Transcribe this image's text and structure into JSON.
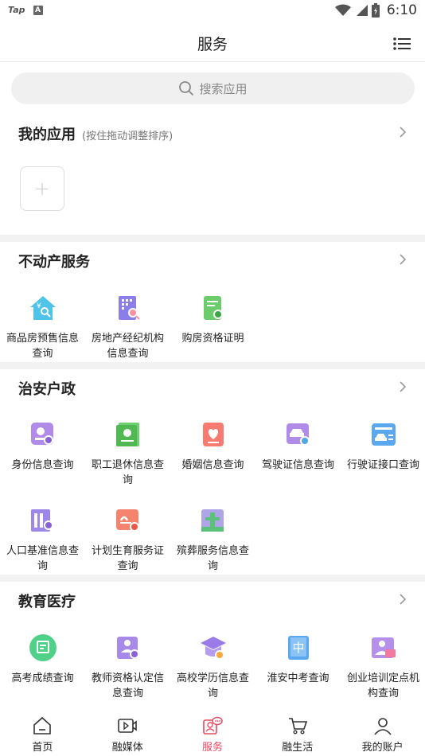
{
  "status_bar": {
    "app_label": "Tap",
    "notification_glyph": "A",
    "time": "6:10"
  },
  "header": {
    "title": "服务"
  },
  "search": {
    "placeholder": "搜索应用"
  },
  "my_apps": {
    "title": "我的应用",
    "subtitle": "(按住拖动调整排序)",
    "add_glyph": "+"
  },
  "sections": [
    {
      "title": "不动产服务",
      "apps": [
        {
          "label": "商品房预售信息查询",
          "icon": "house-search-icon"
        },
        {
          "label": "房地产经纪机构信息查询",
          "icon": "building-search-icon"
        },
        {
          "label": "购房资格证明",
          "icon": "certificate-icon"
        }
      ]
    },
    {
      "title": "治安户政",
      "apps": [
        {
          "label": "身份信息查询",
          "icon": "id-card-search-icon"
        },
        {
          "label": "职工退休信息查询",
          "icon": "retirement-book-icon"
        },
        {
          "label": "婚姻信息查询",
          "icon": "marriage-heart-icon"
        },
        {
          "label": "驾驶证信息查询",
          "icon": "driver-license-icon"
        },
        {
          "label": "行驶证接口查询",
          "icon": "vehicle-license-icon"
        },
        {
          "label": "人口基准信息查询",
          "icon": "population-search-icon"
        },
        {
          "label": "计划生育服务证查询",
          "icon": "family-planning-icon"
        },
        {
          "label": "殡葬服务信息查询",
          "icon": "funeral-service-icon"
        }
      ]
    },
    {
      "title": "教育医疗",
      "apps": [
        {
          "label": "高考成绩查询",
          "icon": "exam-score-icon"
        },
        {
          "label": "教师资格认定信息查询",
          "icon": "teacher-qualification-icon"
        },
        {
          "label": "高校学历信息查询",
          "icon": "graduation-cap-icon"
        },
        {
          "label": "淮安中考查询",
          "icon": "middle-exam-icon"
        },
        {
          "label": "创业培训定点机构查询",
          "icon": "training-institution-icon"
        }
      ]
    }
  ],
  "tabbar": [
    {
      "label": "首页",
      "icon": "home-icon"
    },
    {
      "label": "融媒体",
      "icon": "media-icon"
    },
    {
      "label": "服务",
      "icon": "service-icon",
      "active": true
    },
    {
      "label": "融生活",
      "icon": "cart-icon"
    },
    {
      "label": "我的账户",
      "icon": "user-icon"
    }
  ],
  "colors": {
    "accent": "#e84a5f",
    "divider": "#f2f2f2"
  }
}
